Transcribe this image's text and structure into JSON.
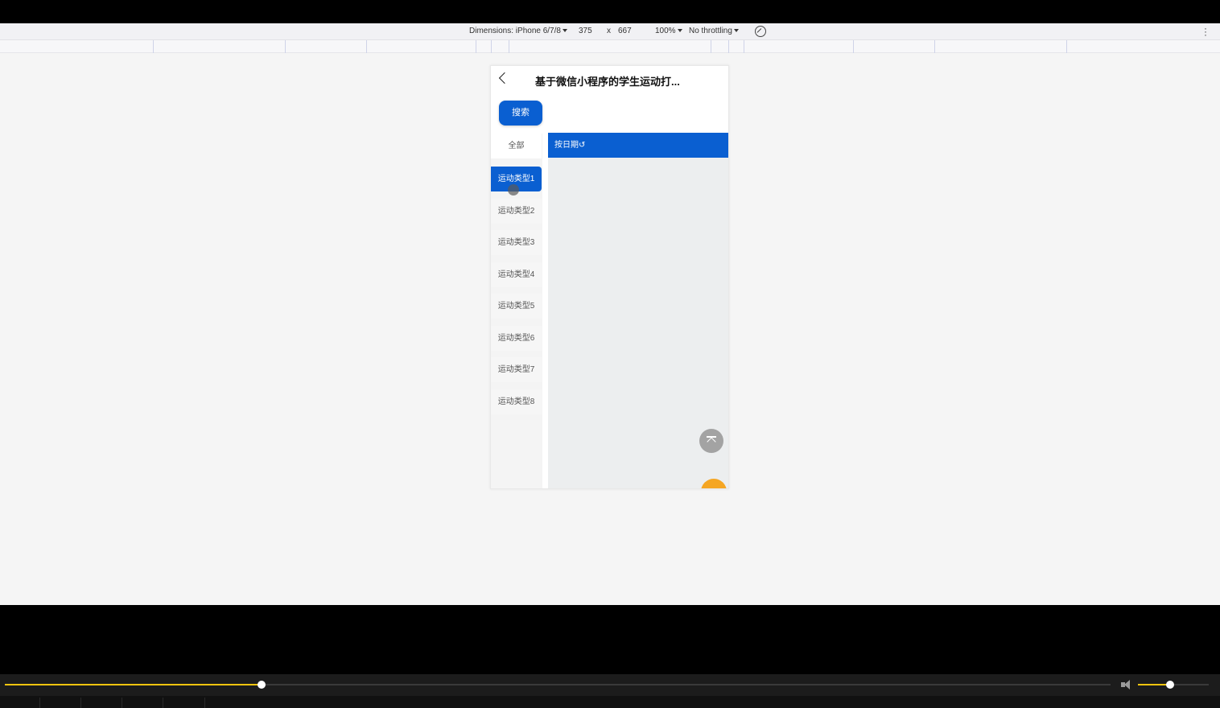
{
  "devtools": {
    "dimensions_label": "Dimensions: iPhone 6/7/8",
    "width_value": "375",
    "times": "x",
    "height_value": "667",
    "zoom": "100%",
    "throttling": "No throttling"
  },
  "app": {
    "title": "基于微信小程序的学生运动打...",
    "search_label": "搜索",
    "date_sort_label": "按日期↺",
    "categories": [
      {
        "label": "全部",
        "active": false
      },
      {
        "label": "运动类型1",
        "active": true
      },
      {
        "label": "运动类型2",
        "active": false
      },
      {
        "label": "运动类型3",
        "active": false
      },
      {
        "label": "运动类型4",
        "active": false
      },
      {
        "label": "运动类型5",
        "active": false
      },
      {
        "label": "运动类型6",
        "active": false
      },
      {
        "label": "运动类型7",
        "active": false
      },
      {
        "label": "运动类型8",
        "active": false
      }
    ],
    "colors": {
      "accent": "#0a5fd1",
      "fab": "#f5a623",
      "top_button": "#a3a3a3"
    }
  },
  "player": {
    "progress": 0.232,
    "volume": 0.45,
    "progress_color": "#f1c40f"
  }
}
